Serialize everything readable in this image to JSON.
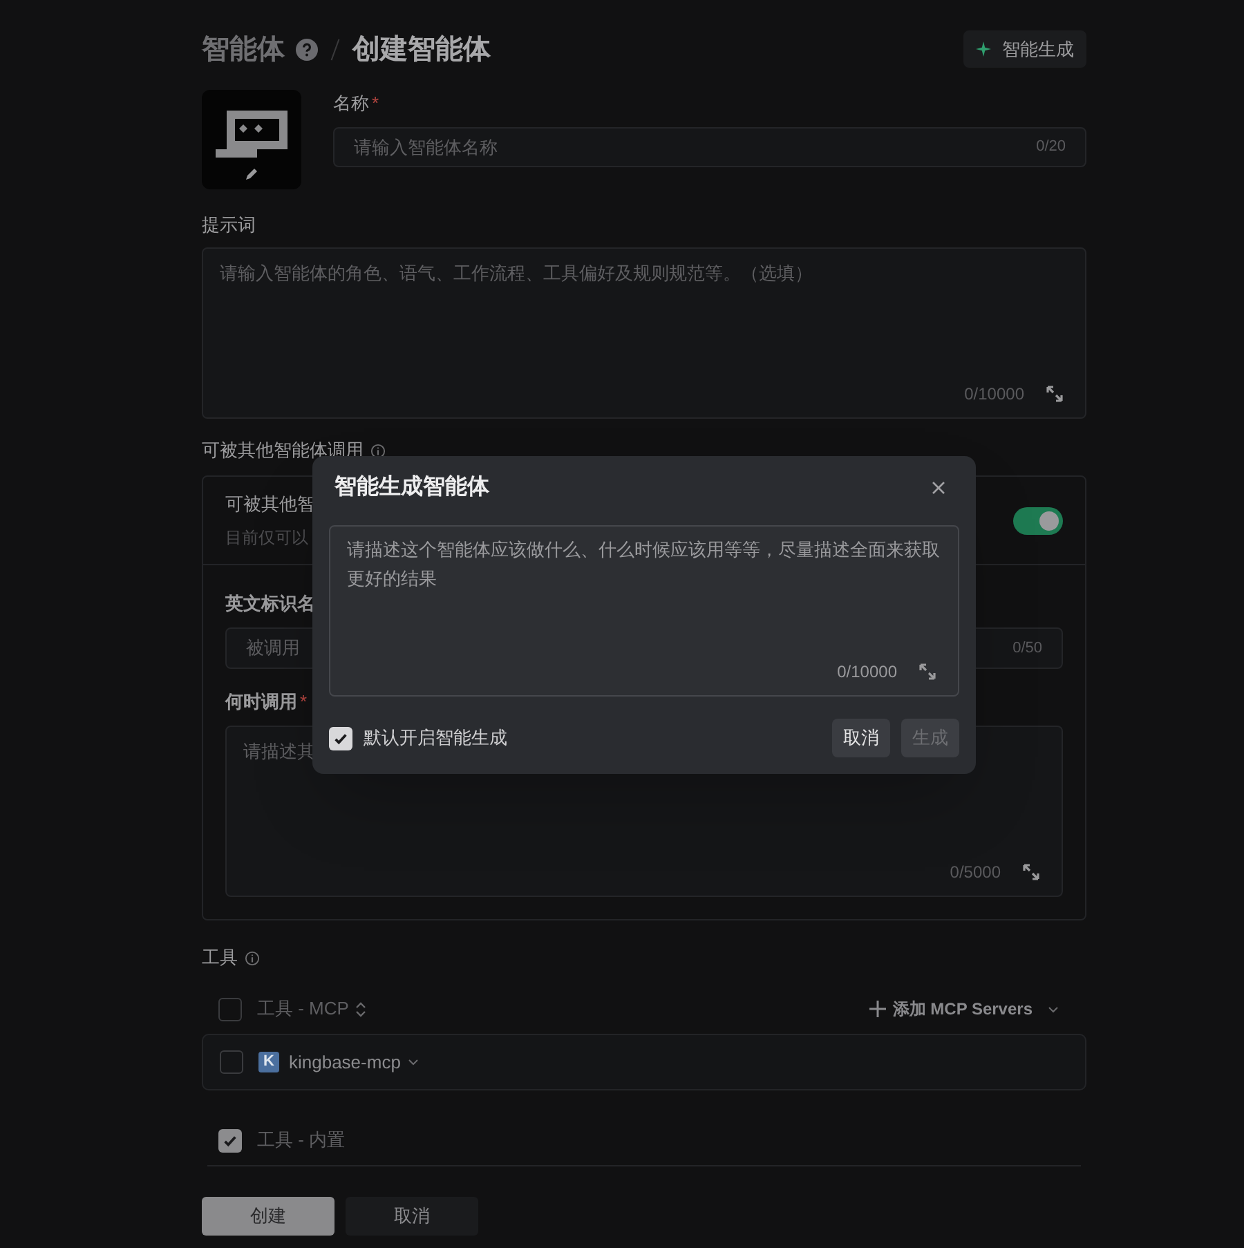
{
  "breadcrumb": [
    {
      "label": "智能体",
      "current": false
    },
    {
      "label": "创建智能体",
      "current": true
    }
  ],
  "header_button": "智能生成",
  "name_field": {
    "label": "名称",
    "required_mark": "*",
    "placeholder": "请输入智能体名称",
    "counter": "0/20"
  },
  "prompt": {
    "label": "提示词",
    "placeholder": "请输入智能体的角色、语气、工作流程、工具偏好及规则规范等。（选填）",
    "counter": "0/10000"
  },
  "callable": {
    "label": "可被其他智能体调用",
    "title": "可被其他智",
    "subtitle": "目前仅可以",
    "on": true,
    "english_name": {
      "label": "英文标识名",
      "placeholder": "被调用",
      "counter": "0/50"
    },
    "when": {
      "label": "何时调用",
      "required_mark": "*",
      "placeholder": "请描述其",
      "counter": "0/5000"
    }
  },
  "tools": {
    "label": "工具",
    "mcp_header": {
      "label": "工具 - MCP",
      "checked": false
    },
    "add_button": "添加 MCP Servers",
    "mcp_servers": [
      {
        "badge": "K",
        "name": "kingbase-mcp",
        "checked": false
      }
    ],
    "builtin": {
      "label": "工具 - 内置",
      "checked": true
    }
  },
  "actions": [
    {
      "label": "创建",
      "primary": true
    },
    {
      "label": "取消",
      "primary": false
    }
  ],
  "dialog": {
    "title": "智能生成智能体",
    "placeholder": "请描述这个智能体应该做什么、什么时候应该用等等，尽量描述全面来获取更好的结果",
    "counter": "0/10000",
    "default_on": {
      "label": "默认开启智能生成",
      "checked": true
    },
    "buttons": [
      {
        "label": "取消",
        "disabled": false
      },
      {
        "label": "生成",
        "disabled": true
      }
    ]
  }
}
